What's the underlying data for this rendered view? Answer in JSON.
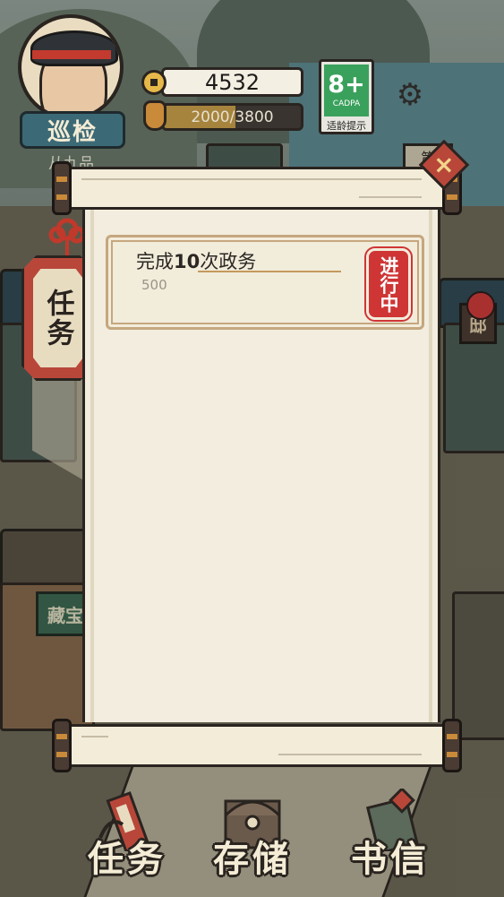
{
  "player": {
    "rank": "巡检",
    "sub_label": "从九品",
    "coins": "4532",
    "exp_text": "2000/3800",
    "exp_fraction": 0.526
  },
  "age_rating": {
    "number": "8+",
    "org": "CADPA",
    "label": "适龄提示"
  },
  "side_tab": {
    "label": "任务"
  },
  "scene": {
    "shop_sign": "藏宝",
    "right_sign": "邸",
    "top_sign": "第"
  },
  "quest_panel": {
    "tasks": [
      {
        "title_prefix": "完成",
        "title_num": "10",
        "title_suffix": "次政务",
        "reward": "500",
        "status": "进行中"
      }
    ]
  },
  "bottom_nav": {
    "items": [
      {
        "label": "任务"
      },
      {
        "label": "存储"
      },
      {
        "label": "书信"
      }
    ]
  },
  "colors": {
    "accent_red": "#cf3535",
    "paper": "#f2edde",
    "card_border": "#c5a77f",
    "coin_gold": "#e6b84a",
    "age_green": "#3aa15c"
  }
}
